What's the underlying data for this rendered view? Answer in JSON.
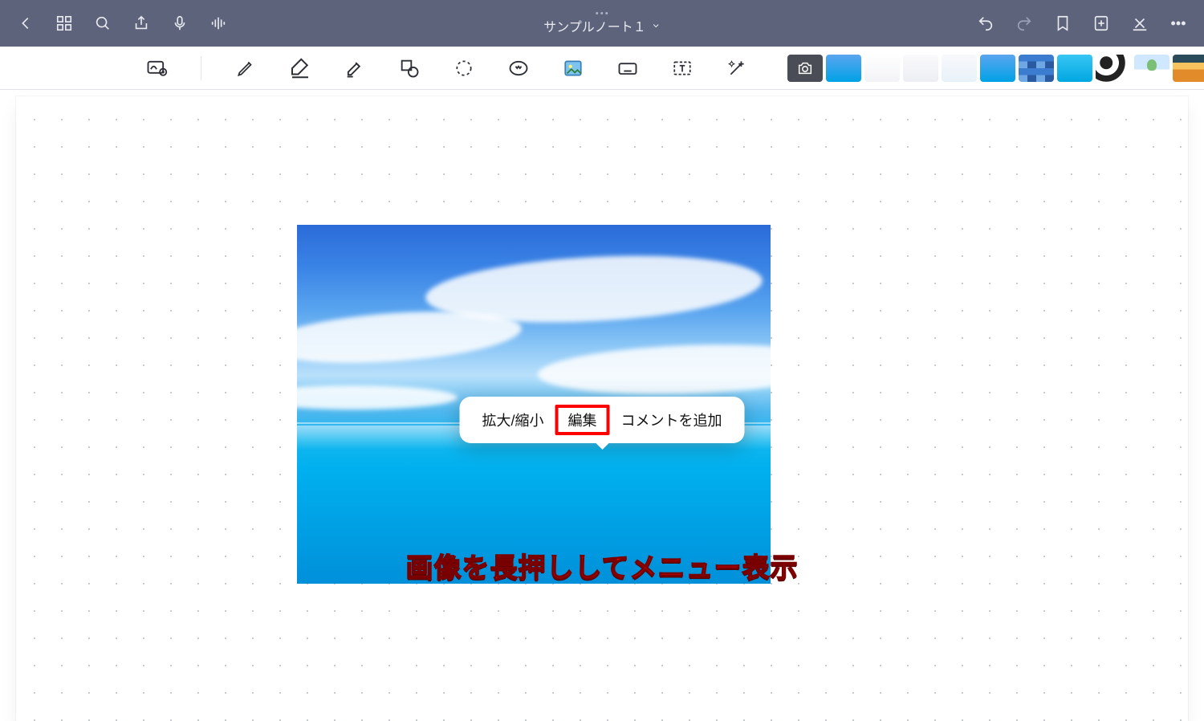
{
  "header": {
    "title": "サンプルノート１",
    "dropdown_icon": "chevron-down-icon"
  },
  "context_menu": {
    "items": [
      {
        "label": "拡大/縮小"
      },
      {
        "label": "編集",
        "highlighted": true
      },
      {
        "label": "コメントを追加"
      }
    ]
  },
  "annotation": {
    "text": "画像を長押ししてメニュー表示"
  },
  "thumbnails": {
    "items": [
      {
        "name": "camera",
        "type": "camera"
      },
      {
        "name": "thumb-1",
        "style": "th-sky"
      },
      {
        "name": "thumb-2",
        "style": "th-grid1"
      },
      {
        "name": "thumb-3",
        "style": "th-grid2"
      },
      {
        "name": "thumb-4",
        "style": "th-grid3"
      },
      {
        "name": "thumb-5",
        "style": "th-sky"
      },
      {
        "name": "thumb-6",
        "style": "th-mosaic"
      },
      {
        "name": "thumb-7",
        "style": "th-cyan"
      },
      {
        "name": "thumb-8",
        "style": "th-bw"
      },
      {
        "name": "thumb-9",
        "style": "th-tree"
      },
      {
        "name": "thumb-10",
        "style": "th-sunset"
      },
      {
        "name": "thumb-11",
        "style": "th-blue"
      },
      {
        "name": "thumb-12",
        "style": "th-floral"
      }
    ]
  }
}
